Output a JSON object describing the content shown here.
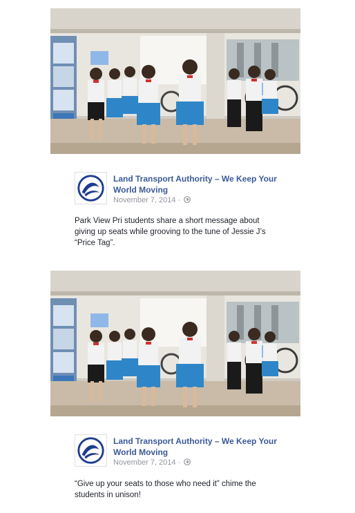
{
  "posts": [
    {
      "page_name": "Land Transport Authority – We Keep Your World Moving",
      "date": "November 7, 2014",
      "separator": "·",
      "privacy_icon": "globe-icon",
      "photo_subject": "Students dancing in a transport station",
      "caption": "Park View Pri students share a short message about giving up seats while grooving to the tune of Jessie J’s “Price Tag”."
    },
    {
      "page_name": "Land Transport Authority – We Keep Your World Moving",
      "date": "November 7, 2014",
      "separator": "·",
      "privacy_icon": "globe-icon",
      "photo_subject": "Students dancing in a transport station",
      "caption": "“Give up your seats to those who need it” chime the students in unison!"
    }
  ],
  "colors": {
    "link": "#3b5998",
    "meta": "#90949c",
    "logo_blue": "#1f3c8f",
    "uniform_skirt": "#2e86c8",
    "uniform_shirt": "#ffffff"
  }
}
